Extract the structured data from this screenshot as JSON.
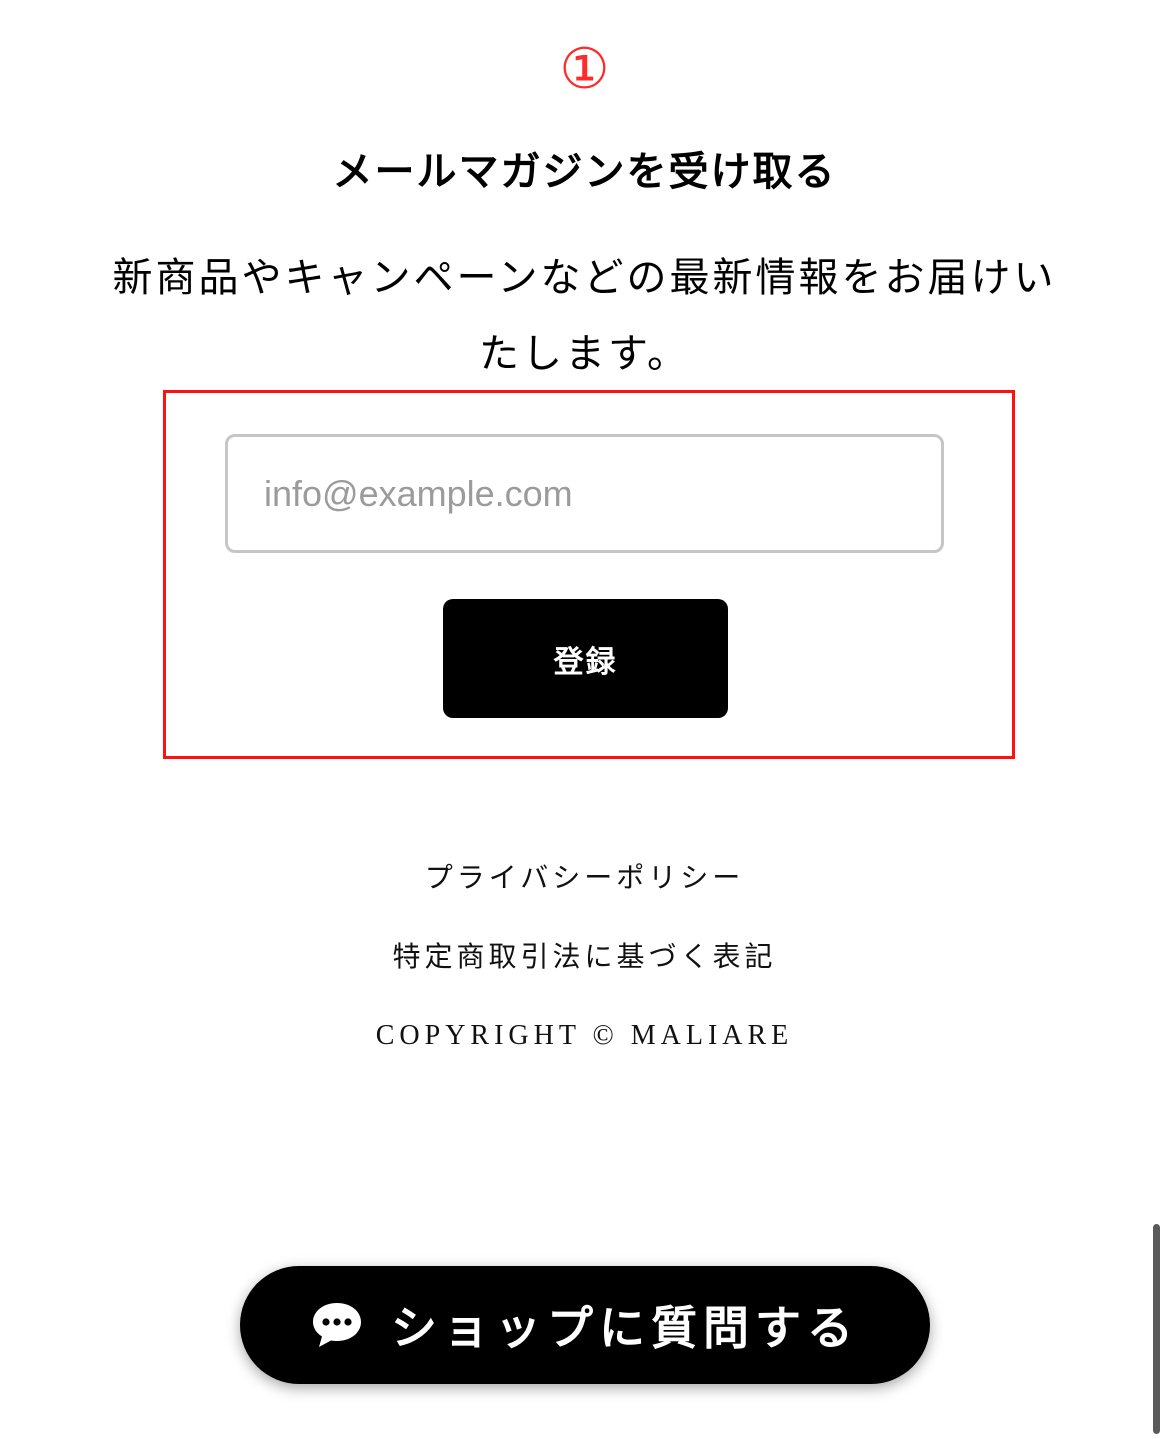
{
  "annotation": {
    "number": "①",
    "highlight_color": "#ff1111"
  },
  "newsletter": {
    "title": "メールマガジンを受け取る",
    "description": "新商品やキャンペーンなどの最新情報をお届けいたします。",
    "email_placeholder": "info@example.com",
    "email_value": "",
    "submit_label": "登録"
  },
  "footer": {
    "privacy_link": "プライバシーポリシー",
    "tokusho_link": "特定商取引法に基づく表記",
    "copyright": "COPYRIGHT © MALIARE"
  },
  "chat": {
    "label": "ショップに質問する",
    "icon": "chat-bubble-icon"
  },
  "colors": {
    "accent": "#000000",
    "annotation_red": "#ff2a2a",
    "input_border": "#c6c6c6",
    "placeholder": "#9b9b9b"
  }
}
